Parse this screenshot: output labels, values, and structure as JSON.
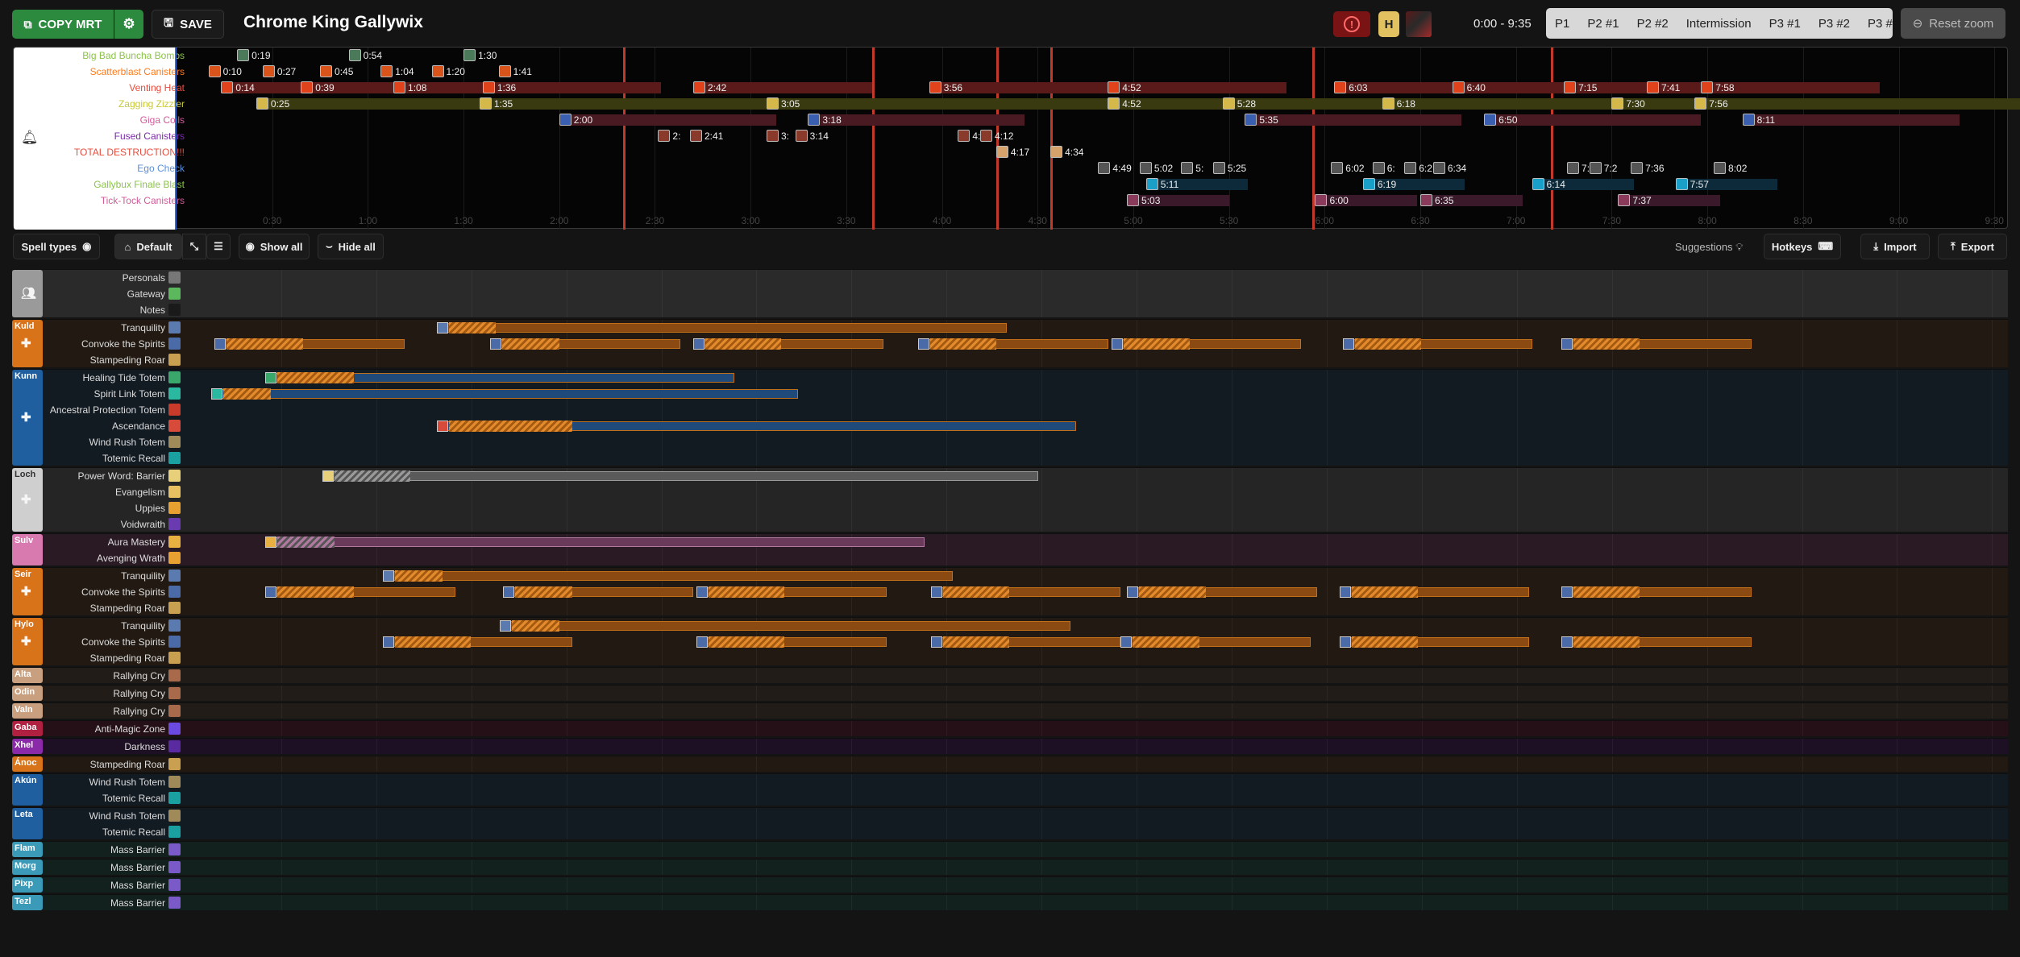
{
  "header": {
    "copy_label": "COPY MRT",
    "save_label": "SAVE",
    "boss_name": "Chrome King Gallywix",
    "warning_icon": "!",
    "difficulty": "H",
    "time_range": "0:00 - 9:35",
    "phases": [
      "P1",
      "P2 #1",
      "P2 #2",
      "Intermission",
      "P3 #1",
      "P3 #2",
      "P3 #"
    ],
    "reset_zoom": "Reset zoom"
  },
  "timeline": {
    "duration_s": 575,
    "ticks": [
      "0:30",
      "1:00",
      "1:30",
      "2:00",
      "2:30",
      "3:00",
      "3:30",
      "4:00",
      "4:30",
      "5:00",
      "5:30",
      "6:00",
      "6:30",
      "7:00",
      "7:30",
      "8:00",
      "8:30",
      "9:00",
      "9:30"
    ],
    "phase_markers_s": [
      140,
      218,
      257,
      274,
      356,
      431
    ],
    "abilities": [
      {
        "name": "Big Bad Buncha Bombs",
        "color": "#8bc34a",
        "icon_color": "#4a7a5a",
        "casts": [
          {
            "t": "0:19",
            "s": 19
          },
          {
            "t": "0:54",
            "s": 54
          },
          {
            "t": "1:30",
            "s": 90
          }
        ]
      },
      {
        "name": "Scatterblast Canisters",
        "color": "#ff7a1a",
        "icon_color": "#d9541a",
        "casts": [
          {
            "t": "0:10",
            "s": 10
          },
          {
            "t": "0:27",
            "s": 27
          },
          {
            "t": "0:45",
            "s": 45
          },
          {
            "t": "1:04",
            "s": 64
          },
          {
            "t": "1:20",
            "s": 80
          },
          {
            "t": "1:41",
            "s": 101
          }
        ]
      },
      {
        "name": "Venting Heat",
        "color": "#e74c3c",
        "icon_color": "#e0431c",
        "bar_color": "#5a1a1a",
        "bar_len_s": 14,
        "casts": [
          {
            "t": "0:14",
            "s": 14
          },
          {
            "t": "0:39",
            "s": 39
          },
          {
            "t": "1:08",
            "s": 68
          },
          {
            "t": "1:36",
            "s": 96
          },
          {
            "t": "2:42",
            "s": 162
          },
          {
            "t": "3:56",
            "s": 236
          },
          {
            "t": "4:52",
            "s": 292
          },
          {
            "t": "6:03",
            "s": 363
          },
          {
            "t": "6:40",
            "s": 400
          },
          {
            "t": "7:15",
            "s": 435
          },
          {
            "t": "7:41",
            "s": 461
          },
          {
            "t": "7:58",
            "s": 478
          }
        ]
      },
      {
        "name": "Zagging Zizzler",
        "color": "#c8c83c",
        "icon_color": "#d4b84a",
        "bar_color": "#3a3a10",
        "bar_len_s": 32,
        "casts": [
          {
            "t": "0:25",
            "s": 25
          },
          {
            "t": "1:35",
            "s": 95
          },
          {
            "t": "3:05",
            "s": 185
          },
          {
            "t": "4:52",
            "s": 292
          },
          {
            "t": "5:28",
            "s": 328
          },
          {
            "t": "6:18",
            "s": 378
          },
          {
            "t": "7:30",
            "s": 450
          },
          {
            "t": "7:56",
            "s": 476
          }
        ]
      },
      {
        "name": "Giga Coils",
        "color": "#d35a9a",
        "icon_color": "#3b5fb0",
        "bar_color": "#4a1a22",
        "bar_len_s": 17,
        "casts": [
          {
            "t": "2:00",
            "s": 120
          },
          {
            "t": "3:18",
            "s": 198
          },
          {
            "t": "5:35",
            "s": 335
          },
          {
            "t": "6:50",
            "s": 410
          },
          {
            "t": "8:11",
            "s": 491
          }
        ]
      },
      {
        "name": "Fused Canisters",
        "color": "#7a2aa8",
        "icon_color": "#8a3a2a",
        "casts": [
          {
            "t": "2:",
            "s": 151
          },
          {
            "t": "2:41",
            "s": 161
          },
          {
            "t": "3:",
            "s": 185
          },
          {
            "t": "3:14",
            "s": 194
          },
          {
            "t": "4:",
            "s": 245
          },
          {
            "t": "4:12",
            "s": 252
          }
        ]
      },
      {
        "name": "TOTAL DESTRUCTION!!!",
        "color": "#e74c3c",
        "icon_color": "#d4a26a",
        "casts": [
          {
            "t": "4:17",
            "s": 257
          },
          {
            "t": "4:34",
            "s": 274
          }
        ]
      },
      {
        "name": "Ego Check",
        "color": "#5b8fd8",
        "icon_color": "#555",
        "casts": [
          {
            "t": "4:49",
            "s": 289
          },
          {
            "t": "5:02",
            "s": 302
          },
          {
            "t": "5:",
            "s": 315
          },
          {
            "t": "5:25",
            "s": 325
          },
          {
            "t": "6:02",
            "s": 362
          },
          {
            "t": "6:",
            "s": 375
          },
          {
            "t": "6:2",
            "s": 385
          },
          {
            "t": "6:34",
            "s": 394
          },
          {
            "t": "7:",
            "s": 436
          },
          {
            "t": "7:2",
            "s": 443
          },
          {
            "t": "7:36",
            "s": 456
          },
          {
            "t": "8:02",
            "s": 482
          }
        ]
      },
      {
        "name": "Gallybux Finale Blast",
        "color": "#8bc34a",
        "icon_color": "#1aa0c8",
        "bar_color": "#0c2a3a",
        "bar_len_s": 8,
        "casts": [
          {
            "t": "5:11",
            "s": 304
          },
          {
            "t": "6:19",
            "s": 372
          },
          {
            "t": "6:14",
            "s": 425
          },
          {
            "t": "7:57",
            "s": 470
          }
        ]
      },
      {
        "name": "Tick-Tock Canisters",
        "color": "#d35a9a",
        "icon_color": "#8a3a5a",
        "bar_color": "#3a1a2a",
        "bar_len_s": 8,
        "casts": [
          {
            "t": "5:03",
            "s": 298
          },
          {
            "t": "6:00",
            "s": 357
          },
          {
            "t": "6:35",
            "s": 390
          },
          {
            "t": "7:37",
            "s": 452
          }
        ]
      }
    ]
  },
  "toolbar": {
    "spell_types": "Spell types",
    "default": "Default",
    "show_all": "Show all",
    "hide_all": "Hide all",
    "suggestions": "Suggestions",
    "hotkeys": "Hotkeys",
    "import": "Import",
    "export": "Export"
  },
  "groups": [
    {
      "name": "",
      "color": "#9a9a9a",
      "bg": "#2a2a2a",
      "icon": true,
      "spells": [
        {
          "label": "Personals",
          "ic": "#777"
        },
        {
          "label": "Gateway",
          "ic": "#5cb85c"
        },
        {
          "label": "Notes",
          "ic": "#1a1a1a"
        }
      ]
    },
    {
      "name": "Kuld",
      "color": "#d9731a",
      "bg": "#221a12",
      "spells": [
        {
          "label": "Tranquility",
          "ic": "#5a7ab0",
          "casts": [
            {
              "s": 79,
              "h": 5,
              "cd": 180
            }
          ]
        },
        {
          "label": "Convoke the Spirits",
          "ic": "#4a6aa8",
          "casts": [
            {
              "s": 9,
              "h": 8,
              "cd": 60
            },
            {
              "s": 96,
              "h": 6,
              "cd": 60
            },
            {
              "s": 160,
              "h": 8,
              "cd": 60
            },
            {
              "s": 231,
              "h": 7,
              "cd": 60
            },
            {
              "s": 292,
              "h": 7,
              "cd": 60
            },
            {
              "s": 365,
              "h": 7,
              "cd": 60
            },
            {
              "s": 434,
              "h": 7,
              "cd": 60
            }
          ]
        },
        {
          "label": "Stampeding Roar",
          "ic": "#c8a050"
        }
      ]
    },
    {
      "name": "Kunn",
      "color": "#1f5fa0",
      "bg": "#121a22",
      "spells": [
        {
          "label": "Healing Tide Totem",
          "ic": "#3aa86a",
          "casts": [
            {
              "s": 25,
              "h": 8,
              "cd": 148,
              "bar": "#1f4a7a"
            }
          ]
        },
        {
          "label": "Spirit Link Totem",
          "ic": "#2ab8a0",
          "casts": [
            {
              "s": 8,
              "h": 5,
              "cd": 185,
              "bar": "#1f4a7a"
            }
          ]
        },
        {
          "label": "Ancestral Protection Totem",
          "ic": "#c83a2a"
        },
        {
          "label": "Ascendance",
          "ic": "#d84a3a",
          "casts": [
            {
              "s": 79,
              "h": 13,
              "cd": 202,
              "bar": "#1f4a7a"
            }
          ]
        },
        {
          "label": "Wind Rush Totem",
          "ic": "#a08a5a"
        },
        {
          "label": "Totemic Recall",
          "ic": "#1aa0a0"
        }
      ]
    },
    {
      "name": "Loch",
      "color": "#cfcfcf",
      "bg": "#252525",
      "fg": "#333",
      "spells": [
        {
          "label": "Power Word: Barrier",
          "ic": "#e8d07a",
          "casts": [
            {
              "s": 43,
              "h": 8,
              "cd": 226,
              "bar": "#5a5a5a",
              "hc": "#9a9a9a"
            }
          ]
        },
        {
          "label": "Evangelism",
          "ic": "#e8c060"
        },
        {
          "label": "Uppies",
          "ic": "#e8a030"
        },
        {
          "label": "Voidwraith",
          "ic": "#6a3ab0"
        }
      ]
    },
    {
      "name": "Sulv",
      "color": "#d87ab0",
      "bg": "#2a1a24",
      "spells": [
        {
          "label": "Aura Mastery",
          "ic": "#e8b040",
          "casts": [
            {
              "s": 25,
              "h": 6,
              "cd": 208,
              "bar": "#6a3a5a",
              "hc": "#b07aa0"
            }
          ]
        },
        {
          "label": "Avenging Wrath",
          "ic": "#e8a030"
        }
      ]
    },
    {
      "name": "Seir",
      "color": "#d9731a",
      "bg": "#221a12",
      "spells": [
        {
          "label": "Tranquility",
          "ic": "#5a7ab0",
          "casts": [
            {
              "s": 62,
              "h": 5,
              "cd": 180
            }
          ]
        },
        {
          "label": "Convoke the Spirits",
          "ic": "#4a6aa8",
          "casts": [
            {
              "s": 25,
              "h": 8,
              "cd": 60
            },
            {
              "s": 100,
              "h": 6,
              "cd": 60
            },
            {
              "s": 161,
              "h": 8,
              "cd": 60
            },
            {
              "s": 235,
              "h": 7,
              "cd": 60
            },
            {
              "s": 297,
              "h": 7,
              "cd": 60
            },
            {
              "s": 364,
              "h": 7,
              "cd": 60
            },
            {
              "s": 434,
              "h": 7,
              "cd": 60
            }
          ]
        },
        {
          "label": "Stampeding Roar",
          "ic": "#c8a050"
        }
      ]
    },
    {
      "name": "Hylo",
      "color": "#d9731a",
      "bg": "#221a12",
      "spells": [
        {
          "label": "Tranquility",
          "ic": "#5a7ab0",
          "casts": [
            {
              "s": 99,
              "h": 5,
              "cd": 180
            }
          ]
        },
        {
          "label": "Convoke the Spirits",
          "ic": "#4a6aa8",
          "casts": [
            {
              "s": 62,
              "h": 8,
              "cd": 60
            },
            {
              "s": 161,
              "h": 8,
              "cd": 60
            },
            {
              "s": 235,
              "h": 7,
              "cd": 60
            },
            {
              "s": 295,
              "h": 7,
              "cd": 60
            },
            {
              "s": 364,
              "h": 7,
              "cd": 60
            },
            {
              "s": 434,
              "h": 7,
              "cd": 60
            }
          ]
        },
        {
          "label": "Stampeding Roar",
          "ic": "#c8a050"
        }
      ]
    },
    {
      "name": "Alta",
      "color": "#c8a080",
      "bg": "#221c18",
      "spells": [
        {
          "label": "Rallying Cry",
          "ic": "#a86a4a"
        }
      ]
    },
    {
      "name": "Odin",
      "color": "#c8a080",
      "bg": "#221c18",
      "spells": [
        {
          "label": "Rallying Cry",
          "ic": "#a86a4a"
        }
      ]
    },
    {
      "name": "Valn",
      "color": "#c8a080",
      "bg": "#221c18",
      "spells": [
        {
          "label": "Rallying Cry",
          "ic": "#a86a4a"
        }
      ]
    },
    {
      "name": "Gaba",
      "color": "#b02040",
      "bg": "#241016",
      "spells": [
        {
          "label": "Anti-Magic Zone",
          "ic": "#6a4ae0"
        }
      ]
    },
    {
      "name": "Xhel",
      "color": "#8a2aa8",
      "bg": "#1e1024",
      "spells": [
        {
          "label": "Darkness",
          "ic": "#5a2aa0"
        }
      ]
    },
    {
      "name": "Ánoc",
      "color": "#d9731a",
      "bg": "#221a12",
      "spells": [
        {
          "label": "Stampeding Roar",
          "ic": "#c8a050"
        }
      ]
    },
    {
      "name": "Akún",
      "color": "#1f5fa0",
      "bg": "#121a22",
      "spells": [
        {
          "label": "Wind Rush Totem",
          "ic": "#a08a5a"
        },
        {
          "label": "Totemic Recall",
          "ic": "#1aa0a0"
        }
      ]
    },
    {
      "name": "Leta",
      "color": "#1f5fa0",
      "bg": "#121a22",
      "spells": [
        {
          "label": "Wind Rush Totem",
          "ic": "#a08a5a"
        },
        {
          "label": "Totemic Recall",
          "ic": "#1aa0a0"
        }
      ]
    },
    {
      "name": "Flam",
      "color": "#3a9ab8",
      "bg": "#12201e",
      "spells": [
        {
          "label": "Mass Barrier",
          "ic": "#7a5ac8"
        }
      ]
    },
    {
      "name": "Morg",
      "color": "#3a9ab8",
      "bg": "#12201e",
      "spells": [
        {
          "label": "Mass Barrier",
          "ic": "#7a5ac8"
        }
      ]
    },
    {
      "name": "Pixp",
      "color": "#3a9ab8",
      "bg": "#12201e",
      "spells": [
        {
          "label": "Mass Barrier",
          "ic": "#7a5ac8"
        }
      ]
    },
    {
      "name": "Tezl",
      "color": "#3a9ab8",
      "bg": "#12201e",
      "spells": [
        {
          "label": "Mass Barrier",
          "ic": "#7a5ac8"
        }
      ]
    }
  ]
}
